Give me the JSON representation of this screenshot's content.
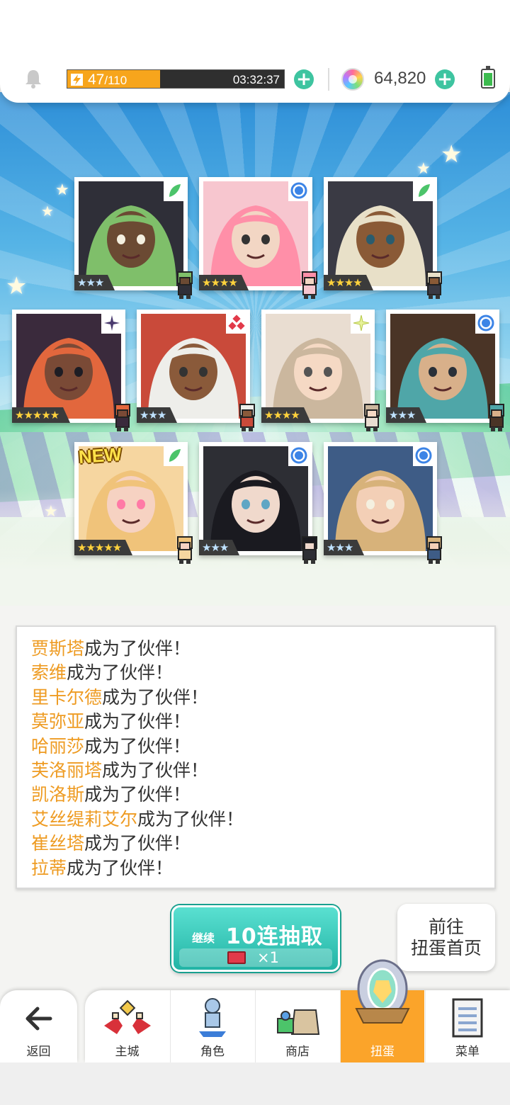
{
  "header": {
    "stamina_current": "47",
    "stamina_max": "/110",
    "stamina_fraction": 0.427,
    "stamina_timer": "03:32:37",
    "gems": "64,820",
    "icons": [
      "bell-icon",
      "bolt-icon",
      "plus-icon",
      "gem-icon",
      "battery-icon"
    ]
  },
  "cards": [
    {
      "stars": "★★★",
      "rarity": 3,
      "element": "leaf",
      "new": false
    },
    {
      "stars": "★★★★",
      "rarity": 4,
      "element": "water",
      "new": false
    },
    {
      "stars": "★★★★",
      "rarity": 4,
      "element": "leaf",
      "new": false
    },
    {
      "stars": "★★★★★",
      "rarity": 5,
      "element": "dark",
      "new": false
    },
    {
      "stars": "★★★",
      "rarity": 3,
      "element": "fire",
      "new": false
    },
    {
      "stars": "★★★★",
      "rarity": 4,
      "element": "light",
      "new": false
    },
    {
      "stars": "★★★",
      "rarity": 3,
      "element": "water",
      "new": false
    },
    {
      "stars": "★★★★★",
      "rarity": 5,
      "element": "leaf",
      "new": true,
      "new_label": "NEW"
    },
    {
      "stars": "★★★",
      "rarity": 3,
      "element": "water",
      "new": false
    },
    {
      "stars": "★★★",
      "rarity": 3,
      "element": "water",
      "new": false
    }
  ],
  "log": {
    "suffix": "成为了伙伴！",
    "names": [
      "贾斯塔",
      "索维",
      "里卡尔德",
      "莫弥亚",
      "哈丽莎",
      "芙洛丽塔",
      "凯洛斯",
      "艾丝缇莉艾尔",
      "崔丝塔",
      "拉蒂"
    ]
  },
  "pull": {
    "continue_label": "继续",
    "label": "10连抽取",
    "cost": "×1"
  },
  "goto": {
    "line1": "前往",
    "line2": "扭蛋首页"
  },
  "nav": {
    "back": "返回",
    "items": [
      "主城",
      "角色",
      "商店",
      "扭蛋",
      "菜单"
    ],
    "active": "扭蛋"
  },
  "colors": {
    "accent_orange": "#fba42a",
    "name_orange": "#ee9b22",
    "teal_button": "#22b4a5",
    "stamina_orange": "#f7a51c"
  }
}
